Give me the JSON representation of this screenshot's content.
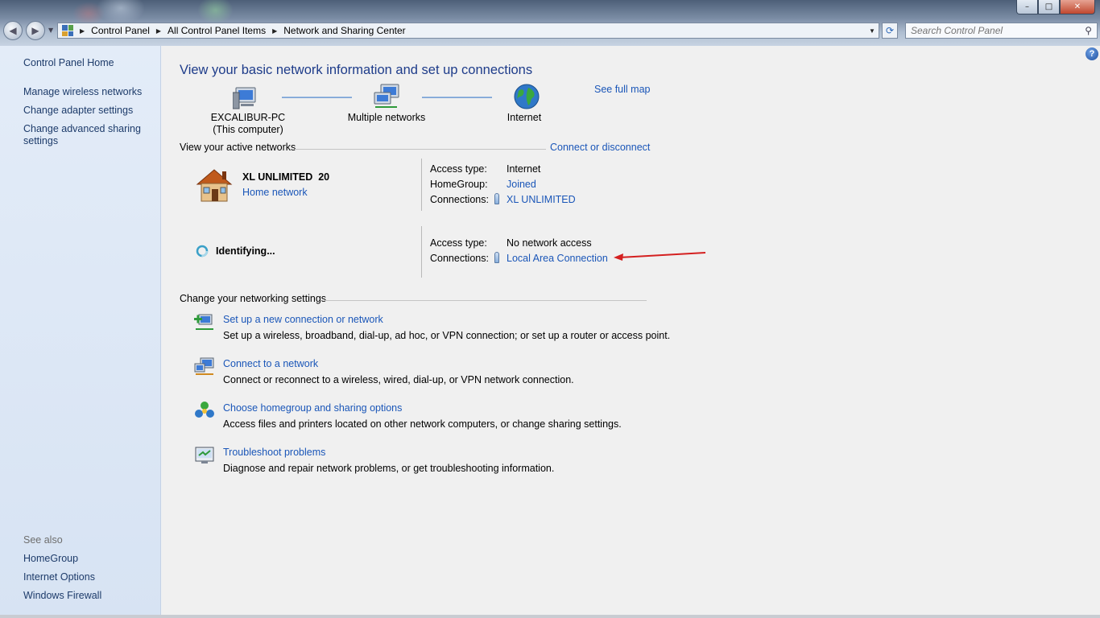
{
  "window": {
    "buttons": {
      "minimize": "–",
      "maximize": "□",
      "close": "✕"
    }
  },
  "address_bar": {
    "breadcrumbs": [
      "Control Panel",
      "All Control Panel Items",
      "Network and Sharing Center"
    ],
    "search_placeholder": "Search Control Panel"
  },
  "left_pane": {
    "home": "Control Panel Home",
    "tasks": [
      "Manage wireless networks",
      "Change adapter settings",
      "Change advanced sharing settings"
    ],
    "see_also_label": "See also",
    "see_also": [
      "HomeGroup",
      "Internet Options",
      "Windows Firewall"
    ]
  },
  "main": {
    "title": "View your basic network information and set up connections",
    "see_full_map": "See full map",
    "map": {
      "computer_name": "EXCALIBUR-PC",
      "computer_sub": "(This computer)",
      "middle": "Multiple networks",
      "internet": "Internet"
    },
    "active_networks": {
      "heading": "View your active networks",
      "connect_link": "Connect or disconnect",
      "network1": {
        "name": "XL UNLIMITED  20",
        "type_link": "Home network",
        "access_type_label": "Access type:",
        "access_type_value": "Internet",
        "homegroup_label": "HomeGroup:",
        "homegroup_value": "Joined",
        "connections_label": "Connections:",
        "connections_value": "XL UNLIMITED"
      },
      "network2": {
        "name": "Identifying...",
        "access_type_label": "Access type:",
        "access_type_value": "No network access",
        "connections_label": "Connections:",
        "connections_value": "Local Area Connection"
      }
    },
    "change_settings": {
      "heading": "Change your networking settings",
      "tasks": [
        {
          "link": "Set up a new connection or network",
          "desc": "Set up a wireless, broadband, dial-up, ad hoc, or VPN connection; or set up a router or access point.",
          "icon": "new-connection-icon"
        },
        {
          "link": "Connect to a network",
          "desc": "Connect or reconnect to a wireless, wired, dial-up, or VPN network connection.",
          "icon": "connect-network-icon"
        },
        {
          "link": "Choose homegroup and sharing options",
          "desc": "Access files and printers located on other network computers, or change sharing settings.",
          "icon": "homegroup-icon"
        },
        {
          "link": "Troubleshoot problems",
          "desc": "Diagnose and repair network problems, or get troubleshooting information.",
          "icon": "troubleshoot-icon"
        }
      ]
    }
  },
  "colors": {
    "link": "#1a56b8",
    "title": "#1e3c8a",
    "annotation_arrow": "#d42020"
  }
}
